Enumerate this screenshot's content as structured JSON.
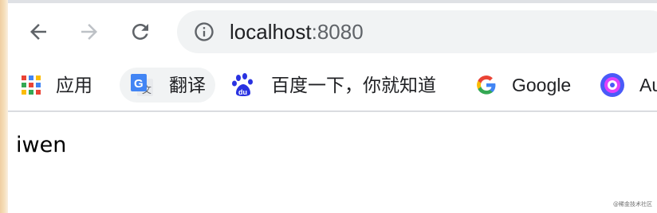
{
  "browser": {
    "address_bar": {
      "host": "localhost",
      "port": ":8080"
    },
    "bookmarks": [
      {
        "label": "应用",
        "icon": "apps-grid-icon"
      },
      {
        "label": "翻译",
        "icon": "google-translate-icon"
      },
      {
        "label": "百度一下，你就知道",
        "icon": "baidu-paw-icon"
      },
      {
        "label": "Google",
        "icon": "google-g-icon"
      },
      {
        "label": "Au",
        "icon": "extension-circle-icon"
      }
    ]
  },
  "page": {
    "text": "iwen"
  },
  "watermark": "@稀金技术社区",
  "colors": {
    "toolbar_bg": "#ffffff",
    "omnibox_bg": "#f1f3f4",
    "icon_gray": "#5f6368",
    "icon_disabled": "#bdc1c6"
  }
}
